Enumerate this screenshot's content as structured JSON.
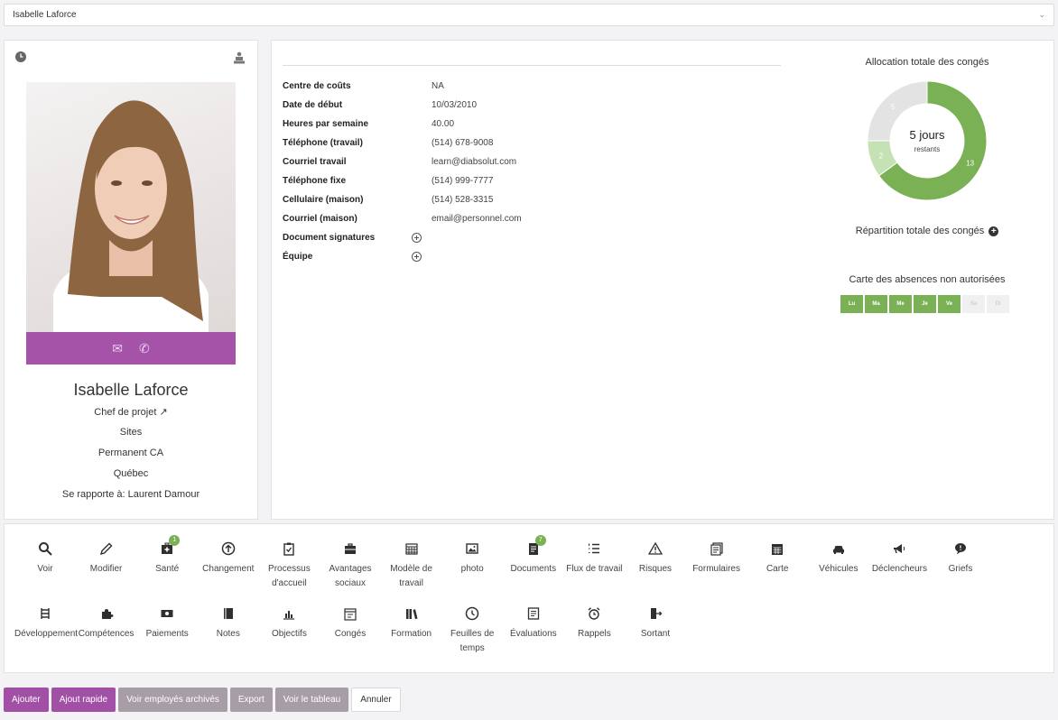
{
  "employee_select": {
    "value": "Isabelle Laforce"
  },
  "profile": {
    "name": "Isabelle Laforce",
    "title": "Chef de projet",
    "site": "Sites",
    "status": "Permanent CA",
    "location": "Québec",
    "reports_to": "Se rapporte à: Laurent Damour"
  },
  "details": [
    {
      "label": "Centre de coûts",
      "value": "NA"
    },
    {
      "label": "Date de début",
      "value": "10/03/2010"
    },
    {
      "label": "Heures par semaine",
      "value": "40.00"
    },
    {
      "label": "Téléphone (travail)",
      "value": "(514) 678-9008"
    },
    {
      "label": "Courriel travail",
      "value": "learn@diabsolut.com"
    },
    {
      "label": "Téléphone fixe",
      "value": "(514) 999-7777"
    },
    {
      "label": "Cellulaire (maison)",
      "value": "(514) 528-3315"
    },
    {
      "label": "Courriel (maison)",
      "value": "email@personnel.com"
    },
    {
      "label": "Document signatures",
      "value": ""
    },
    {
      "label": "Équipe",
      "value": ""
    }
  ],
  "leave": {
    "title": "Allocation totale des congés",
    "center_value": "5 jours",
    "center_label": "restants",
    "distribution_title": "Répartition totale des congés",
    "absence_title": "Carte des absences non autorisées"
  },
  "chart_data": {
    "type": "pie",
    "title": "Allocation totale des congés",
    "categories": [
      "13",
      "2",
      "5"
    ],
    "values": [
      13,
      2,
      5
    ],
    "colors": [
      "#7ab155",
      "#c5e2b4",
      "#e3e3e3"
    ]
  },
  "absence_days": [
    {
      "label": "Lu",
      "active": true
    },
    {
      "label": "Ma",
      "active": true
    },
    {
      "label": "Me",
      "active": true
    },
    {
      "label": "Je",
      "active": true
    },
    {
      "label": "Ve",
      "active": true
    },
    {
      "label": "Sa",
      "active": false
    },
    {
      "label": "Di",
      "active": false
    }
  ],
  "actions": [
    {
      "label": "Voir",
      "icon": "search-icon"
    },
    {
      "label": "Modifier",
      "icon": "pencil-icon"
    },
    {
      "label": "Santé",
      "icon": "medical-kit-icon",
      "badge": "1"
    },
    {
      "label": "Changement",
      "icon": "arrow-up-circle-icon"
    },
    {
      "label": "Processus d'accueil",
      "icon": "clipboard-check-icon"
    },
    {
      "label": "Avantages sociaux",
      "icon": "briefcase-icon"
    },
    {
      "label": "Modèle de travail",
      "icon": "calendar-grid-icon"
    },
    {
      "label": "photo",
      "icon": "image-icon"
    },
    {
      "label": "Documents",
      "icon": "documents-icon",
      "badge": "7"
    },
    {
      "label": "Flux de travail",
      "icon": "list-ordered-icon"
    },
    {
      "label": "Risques",
      "icon": "warning-icon"
    },
    {
      "label": "Formulaires",
      "icon": "forms-icon"
    },
    {
      "label": "Carte",
      "icon": "calendar-icon"
    },
    {
      "label": "Véhicules",
      "icon": "car-icon"
    },
    {
      "label": "Déclencheurs",
      "icon": "megaphone-icon"
    },
    {
      "label": "Griefs",
      "icon": "speech-bubble-icon"
    },
    {
      "label": "Développement",
      "icon": "development-icon"
    },
    {
      "label": "Compétences",
      "icon": "puzzle-icon"
    },
    {
      "label": "Paiements",
      "icon": "money-icon"
    },
    {
      "label": "Notes",
      "icon": "notebook-icon"
    },
    {
      "label": "Objectifs",
      "icon": "bar-chart-icon"
    },
    {
      "label": "Congés",
      "icon": "calendar-leave-icon"
    },
    {
      "label": "Formation",
      "icon": "books-icon"
    },
    {
      "label": "Feuilles de temps",
      "icon": "clock-icon"
    },
    {
      "label": "Évaluations",
      "icon": "evaluation-icon"
    },
    {
      "label": "Rappels",
      "icon": "alarm-icon"
    },
    {
      "label": "Sortant",
      "icon": "exit-icon"
    }
  ],
  "buttons": {
    "add": "Ajouter",
    "quick_add": "Ajout rapide",
    "archived": "Voir employés archivés",
    "export": "Export",
    "board": "Voir le tableau",
    "cancel": "Annuler"
  }
}
